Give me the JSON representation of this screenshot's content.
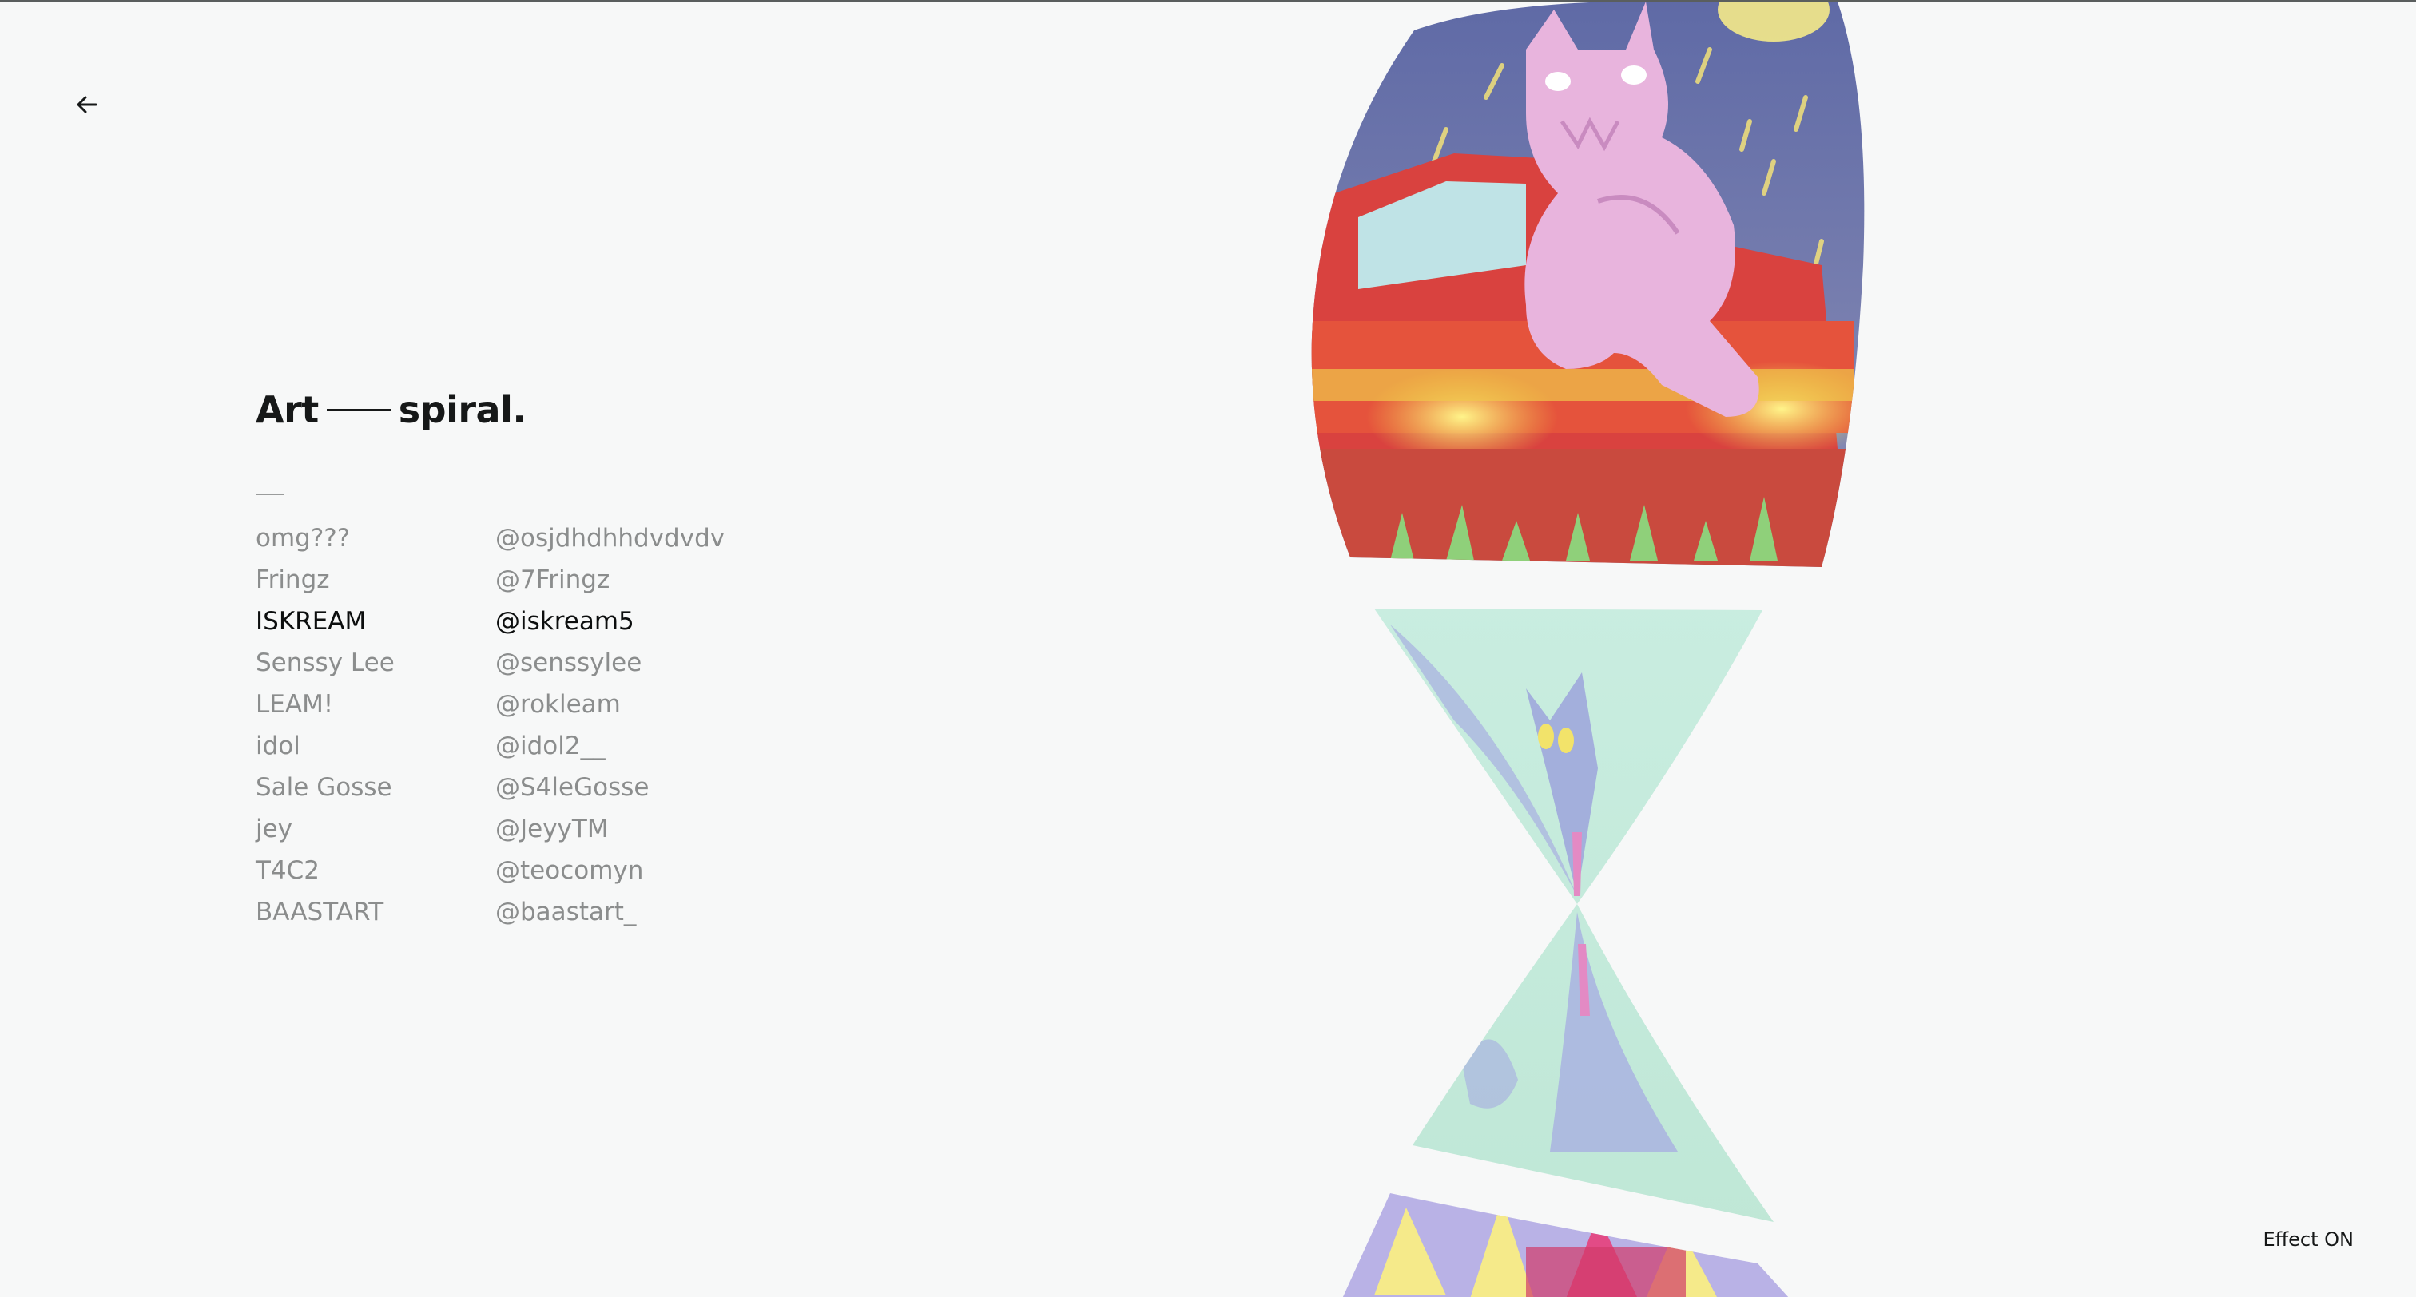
{
  "nav": {
    "back_icon": "arrow-left-icon"
  },
  "heading": {
    "part1": "Art",
    "part2": "spiral."
  },
  "credits": [
    {
      "name": "omg???",
      "handle": "@osjdhdhhdvdvdv",
      "active": false
    },
    {
      "name": "Fringz",
      "handle": "@7Fringz",
      "active": false
    },
    {
      "name": "ISKREAM",
      "handle": "@iskream5",
      "active": true
    },
    {
      "name": "Senssy Lee",
      "handle": "@senssylee",
      "active": false
    },
    {
      "name": "LEAM!",
      "handle": "@rokleam",
      "active": false
    },
    {
      "name": "idol",
      "handle": "@idol2__",
      "active": false
    },
    {
      "name": "Sale Gosse",
      "handle": "@S4leGosse",
      "active": false
    },
    {
      "name": "jey",
      "handle": "@JeyyTM",
      "active": false
    },
    {
      "name": "T4C2",
      "handle": "@teocomyn",
      "active": false
    },
    {
      "name": "BAASTART",
      "handle": "@baastart_",
      "active": false
    }
  ],
  "effect_toggle": {
    "label": "Effect ON"
  },
  "colors": {
    "background": "#f7f8f8",
    "text_primary": "#161818",
    "text_muted": "#8b8d8d",
    "art_sky": "#7077a8",
    "art_creature": "#e8b4dd",
    "art_car": "#e0453a",
    "art_glow": "#f2d84a",
    "art_mint": "#c6ebdc",
    "art_lavender": "#a9b3e0"
  }
}
